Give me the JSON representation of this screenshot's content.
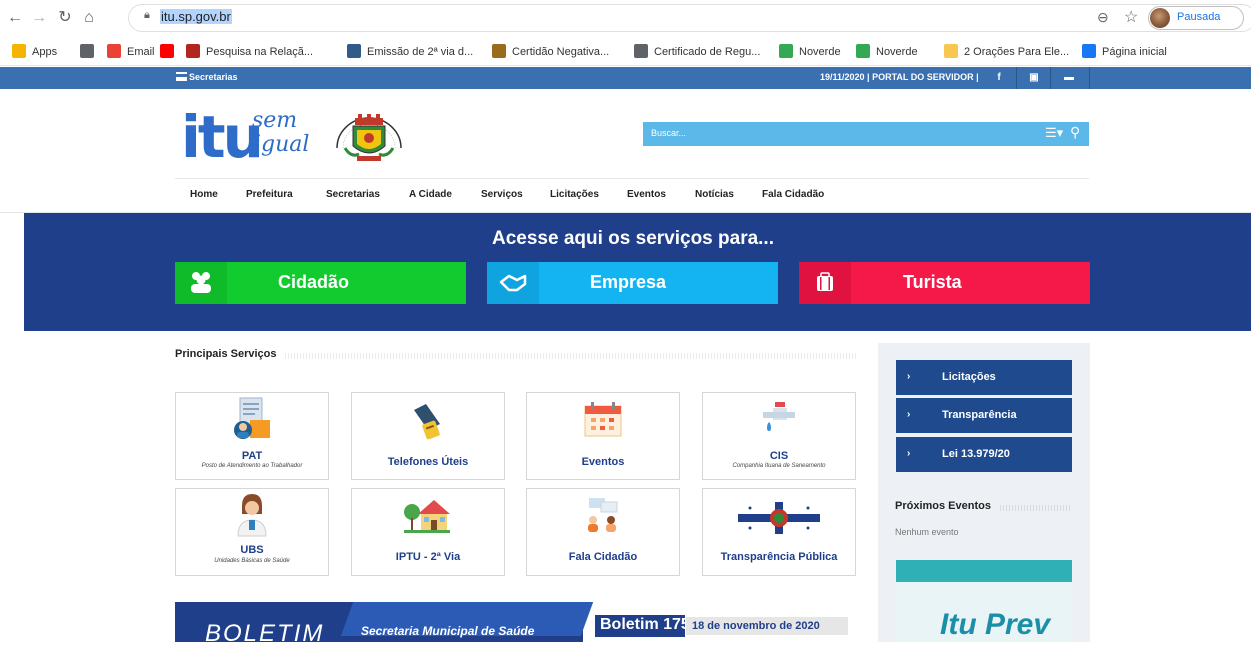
{
  "browser": {
    "url_prefix": "",
    "url": "itu.sp.gov.br",
    "profile_label": "Pausada",
    "bookmarks": [
      {
        "label": "Apps",
        "color": "#f4b400"
      },
      {
        "label": "",
        "color": "#5f6368"
      },
      {
        "label": "Email",
        "color": "#ea4335"
      },
      {
        "label": "",
        "color": "#ff0000"
      },
      {
        "label": "Pesquisa na Relaçã...",
        "color": "#b3261e"
      },
      {
        "label": "Emissão de 2ª via d...",
        "color": "#2f5a8b"
      },
      {
        "label": "Certidão Negativa...",
        "color": "#9b6a1b"
      },
      {
        "label": "Certificado de Regu...",
        "color": "#5f6368"
      },
      {
        "label": "Noverde",
        "color": "#34a853"
      },
      {
        "label": "Noverde",
        "color": "#34a853"
      },
      {
        "label": "2 Orações Para Ele...",
        "color": "#f9c74f"
      },
      {
        "label": "Página inicial",
        "color": "#1877f2"
      }
    ]
  },
  "topbar": {
    "secretarias": "Secretarias",
    "info": "19/11/2020  | PORTAL DO SERVIDOR |",
    "social": [
      "f",
      "▣",
      "▬"
    ]
  },
  "header": {
    "logo_main": "itu",
    "logo_sem": "sem",
    "logo_igual": "igual",
    "search_placeholder": "Buscar..."
  },
  "nav": [
    "Home",
    "Prefeitura",
    "Secretarias",
    "A Cidade",
    "Serviços",
    "Licitações",
    "Eventos",
    "Notícias",
    "Fala Cidadão"
  ],
  "banner": {
    "title": "Acesse aqui os serviços para...",
    "buttons": [
      {
        "label": "Cidadão",
        "icon": "users-icon",
        "color": "#12cc2f",
        "icon_color": "#0fbb28"
      },
      {
        "label": "Empresa",
        "icon": "handshake-icon",
        "color": "#14b4f2",
        "icon_color": "#0fa4df"
      },
      {
        "label": "Turista",
        "icon": "suitcase-icon",
        "color": "#f5194a",
        "icon_color": "#e0123f"
      }
    ]
  },
  "main": {
    "section_title": "Principais Serviços",
    "cards": [
      {
        "title": "PAT",
        "sub": "Posto de Atendimento ao Trabalhador",
        "icon": "worker-document-icon"
      },
      {
        "title": "Telefones Úteis",
        "sub": "",
        "icon": "telephone-icon"
      },
      {
        "title": "Eventos",
        "sub": "",
        "icon": "calendar-icon"
      },
      {
        "title": "CIS",
        "sub": "Companhia Ituana de Saneamento",
        "icon": "water-tap-icon"
      },
      {
        "title": "UBS",
        "sub": "Unidades Básicas de Saúde",
        "icon": "doctor-icon"
      },
      {
        "title": "IPTU - 2ª Via",
        "sub": "",
        "icon": "house-icon"
      },
      {
        "title": "Fala Cidadão",
        "sub": "",
        "icon": "conversation-icon"
      },
      {
        "title": "Transparência Pública",
        "sub": "",
        "icon": "city-flag-icon"
      }
    ],
    "boletim": {
      "title": "BOLETIM",
      "subtitle": "Secretaria Municipal de Saúde",
      "number": "Boletim 175",
      "date": "18 de novembro de 2020"
    }
  },
  "sidebar": {
    "buttons": [
      "Licitações",
      "Transparência",
      "Lei 13.979/20"
    ],
    "events_title": "Próximos Eventos",
    "events_empty": "Nenhum evento",
    "itu_prev": "Itu Prev"
  }
}
